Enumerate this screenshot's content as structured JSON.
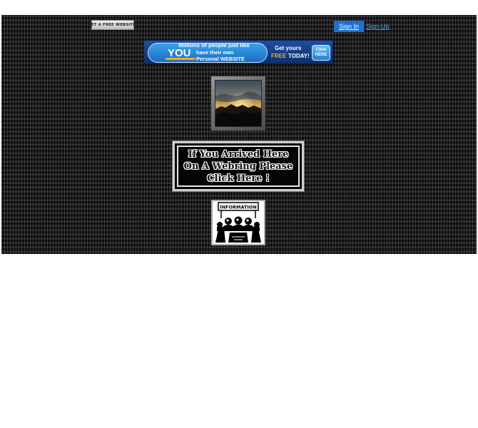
{
  "top_bar": {
    "free_site_label": "GET A FREE WEBSITE!",
    "signin_label": "Sign In",
    "signup_label": "Sign-Up"
  },
  "banner": {
    "line1": "Millions of people just like",
    "you": "YOU",
    "line2": "have their own",
    "line3": "Personal WEBSITE",
    "get_yours": "Get yours",
    "free": "FREE",
    "today": "TODAY!",
    "click": "Click",
    "here": "HERE"
  },
  "webring_button": {
    "line1": "If You Arrived Here",
    "line2": "On A Webring Please",
    "line3": "Click Here !"
  },
  "info_image": {
    "label": "INFORMATION"
  },
  "colors": {
    "page_bg": "#151515",
    "signin_bg": "#1f6fd0",
    "signup_link": "#4aa6e8",
    "banner_accent": "#f7a81b"
  }
}
